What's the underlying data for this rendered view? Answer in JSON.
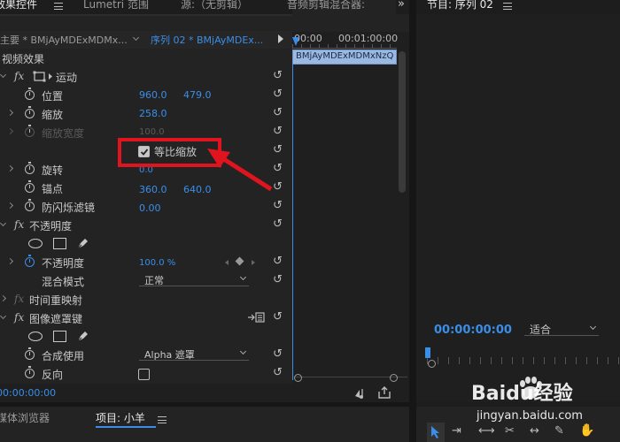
{
  "panels": {
    "effects_tab": "效果控件",
    "lumetri_tab": "Lumetri 范围",
    "source_tab": "源:（无剪辑）",
    "audio_mixer_tab": "音频剪辑混合器:",
    "program_tab": "节目: 序列 02",
    "media_browser_tab": "媒体浏览器",
    "project_tab": "项目: 小羊"
  },
  "effects": {
    "master_label": "主要 * BMjAyMDExMDMx...",
    "sequence_label": "序列 02 * BMjAyMDEx...",
    "video_effects_heading": "视频效果",
    "motion": {
      "name": "运动",
      "position_label": "位置",
      "position_x": "960.0",
      "position_y": "479.0",
      "scale_label": "缩放",
      "scale_value": "258.0",
      "scale_width_label": "缩放宽度",
      "scale_width_value": "100.0",
      "uniform_scale_label": "等比缩放",
      "rotation_label": "旋转",
      "rotation_value": "0.0",
      "anchor_label": "锚点",
      "anchor_x": "360.0",
      "anchor_y": "640.0",
      "antiflicker_label": "防闪烁滤镜",
      "antiflicker_value": "0.00"
    },
    "opacity": {
      "name": "不透明度",
      "opacity_label": "不透明度",
      "opacity_value": "100.0 %",
      "blend_label": "混合模式",
      "blend_value": "正常"
    },
    "time_remap": {
      "name": "时间重映射"
    },
    "track_matte": {
      "name": "图像遮罩键",
      "composite_label": "合成使用",
      "composite_value": "Alpha 遮罩",
      "reverse_label": "反向"
    },
    "timecode": "00:00:00:00"
  },
  "timeline": {
    "tc_start": "00:00",
    "tc_end": "00:01:00:00",
    "clip_name": "BMjAyMDExMDMxNzQ"
  },
  "program": {
    "timecode": "00:00:00:00",
    "fit_value": "适合"
  },
  "watermark": {
    "brand": "Baidu经验",
    "url": "jingyan.baidu.com"
  },
  "colors": {
    "accent_blue": "#3b8ee8",
    "annotation_red": "#e0141e"
  }
}
